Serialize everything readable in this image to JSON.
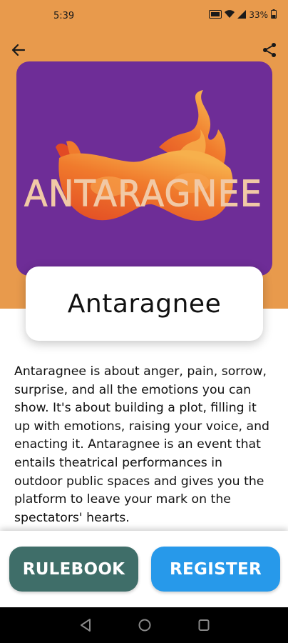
{
  "status_bar": {
    "time": "5:39",
    "battery": "33%",
    "icons": [
      "volte-icon",
      "wifi-icon",
      "signal-icon",
      "battery-icon"
    ]
  },
  "toolbar": {
    "back_icon": "arrow-back-icon",
    "share_icon": "share-icon"
  },
  "poster": {
    "logo_text": "ANTARAGNEE",
    "background_color": "#6e2d97",
    "logo_colors": [
      "#f7b04c",
      "#e24a24",
      "#f1c9a6"
    ]
  },
  "event": {
    "title": "Antaragnee",
    "description": "Antaragnee is about anger, pain, sorrow, surprise, and all the emotions you can show. It's about building a plot, filling it up with emotions, raising your voice, and enacting it. Antaragnee is an event that entails theatrical performances in outdoor public spaces and gives you the platform to leave your mark on the spectators' hearts."
  },
  "actions": {
    "rulebook_label": "RULEBOOK",
    "register_label": "REGISTER"
  },
  "colors": {
    "header": "#e89a4c",
    "rulebook_button": "#3f6e69",
    "register_button": "#2799ea"
  },
  "system_nav": {
    "icons": [
      "nav-back-icon",
      "nav-home-icon",
      "nav-recents-icon"
    ]
  }
}
